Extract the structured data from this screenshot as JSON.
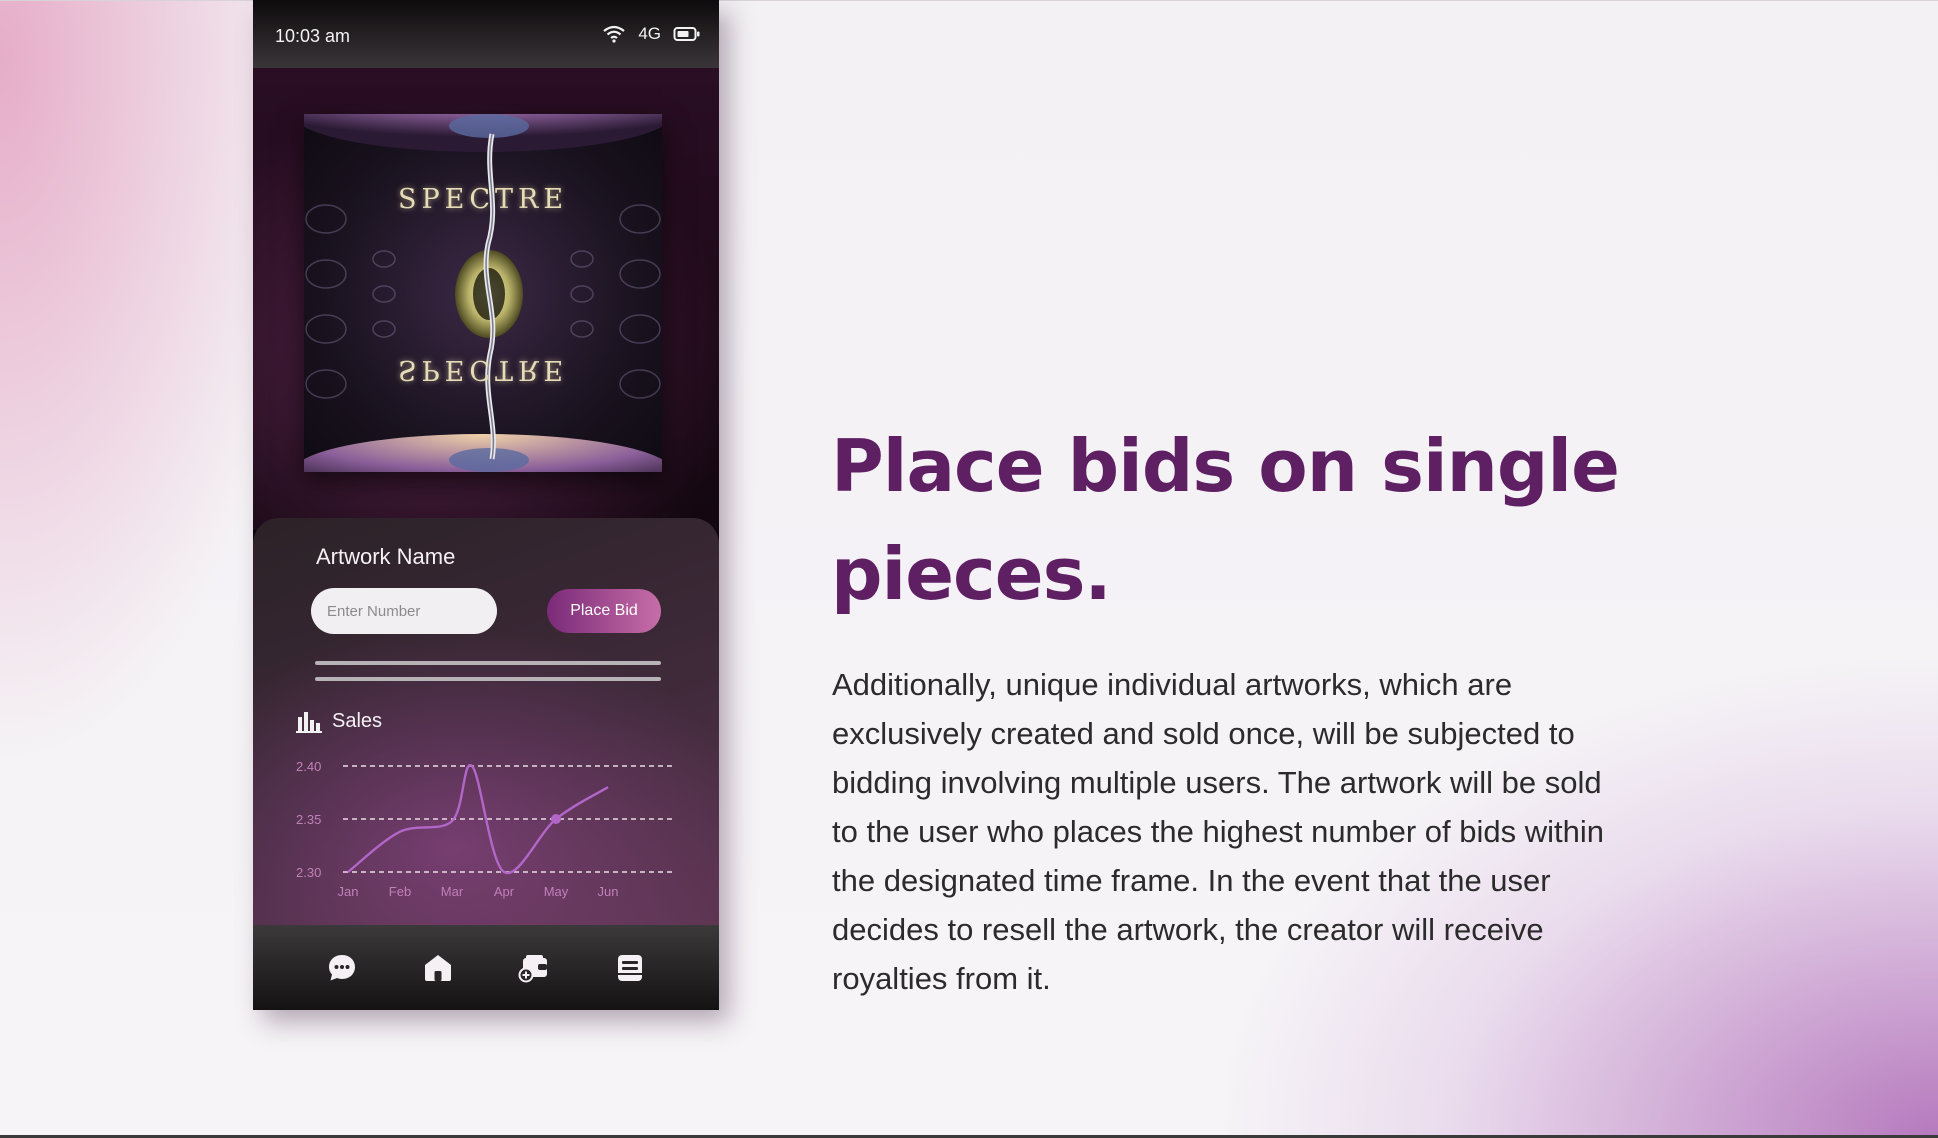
{
  "status_bar": {
    "time": "10:03 am",
    "network": "4G"
  },
  "artwork": {
    "title_top": "SPECTRE",
    "title_bottom": "SPECTRE"
  },
  "bid_card": {
    "artwork_name": "Artwork Name",
    "input_placeholder": "Enter Number",
    "button_label": "Place Bid"
  },
  "sales": {
    "label": "Sales",
    "chart_data": {
      "type": "line",
      "x": [
        "Jan",
        "Feb",
        "Mar",
        "Apr",
        "May",
        "Jun"
      ],
      "series": [
        {
          "values": [
            2.3,
            2.338,
            2.348,
            2.3,
            2.35,
            2.38
          ]
        }
      ],
      "y_ticks": [
        "2.40",
        "2.35",
        "2.30"
      ],
      "ylim": [
        2.3,
        2.4
      ],
      "grid": true,
      "highlighted_point": {
        "x": "May",
        "y": 2.35
      },
      "line_color": "#b266c8"
    }
  },
  "nav": {
    "items": [
      {
        "icon": "chat-icon"
      },
      {
        "icon": "home-icon"
      },
      {
        "icon": "wallet-add-icon"
      },
      {
        "icon": "document-icon"
      }
    ]
  },
  "headline": "Place bids on single pieces.",
  "description": "Additionally, unique individual artworks, which are exclusively created and sold once, will be subjected to bidding involving multiple users. The artwork will be sold to the user who places the highest number of bids within the designated time frame. In the event that the user decides to resell the artwork, the creator will receive royalties from it.",
  "colors": {
    "accent": "#5e1f63",
    "button_start": "#7a2a78",
    "button_end": "#c76ea8"
  }
}
